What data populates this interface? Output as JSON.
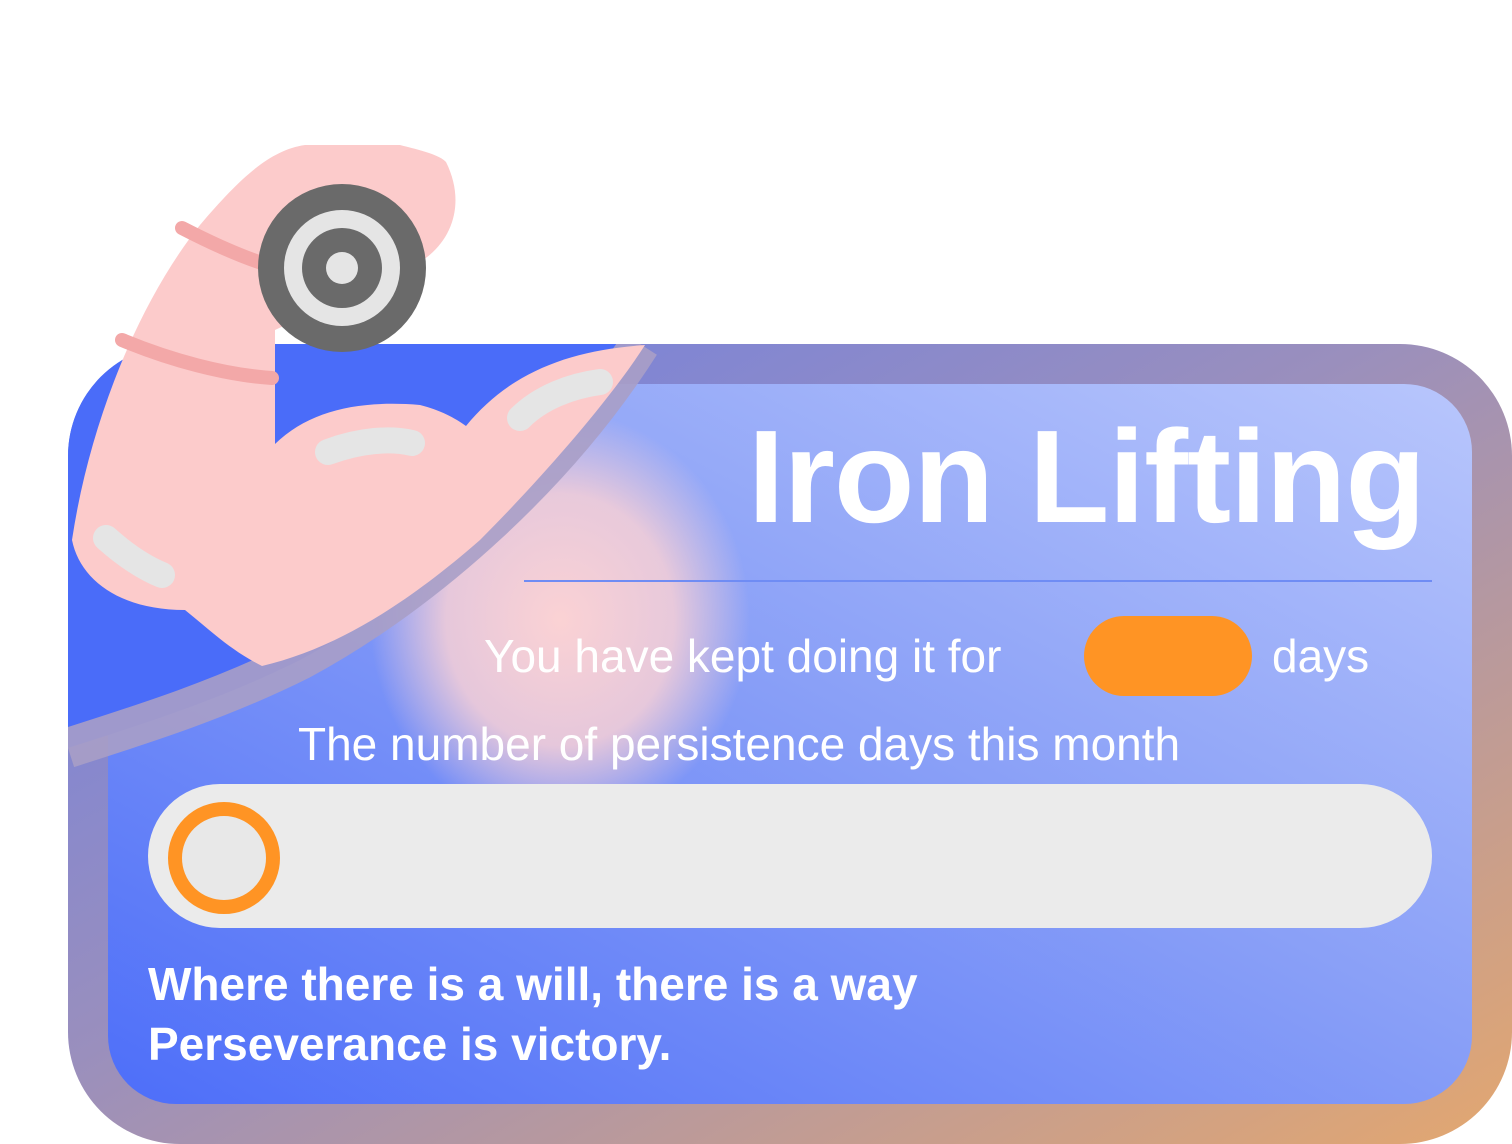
{
  "card": {
    "title": "Iron Lifting",
    "streak_prefix": "You have kept doing it for",
    "streak_days": "",
    "streak_suffix": "days",
    "month_label": "The number of persistence days this month",
    "month_progress": 0,
    "motto_line1": "Where there is a will, there is a way",
    "motto_line2": "Perseverance is victory."
  },
  "icons": {
    "arm": "flexed-arm-icon",
    "weight": "weight-plate-icon"
  },
  "colors": {
    "card_blue": "#4a6cf9",
    "accent_orange": "#ff9424",
    "skin": "#fccbcb",
    "plate": "#6a6a6a",
    "track": "#ebebeb"
  }
}
